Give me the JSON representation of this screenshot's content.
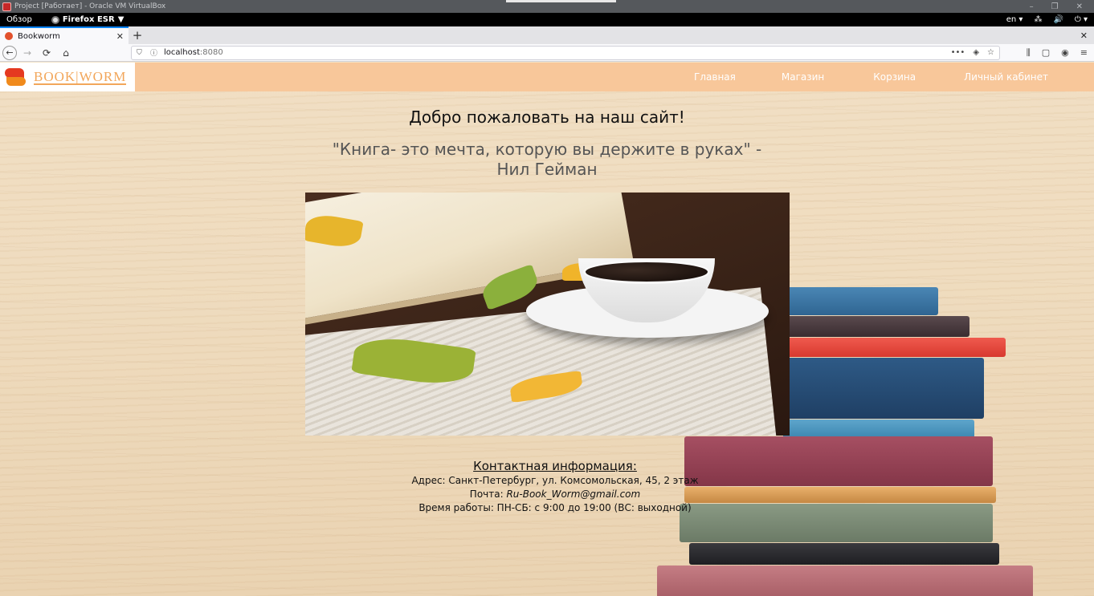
{
  "vbox": {
    "title": "Project [Работает] - Oracle VM VirtualBox",
    "controls": [
      "–",
      "❐",
      "✕"
    ]
  },
  "gnome": {
    "overview": "Обзор",
    "app_name": "Firefox ESR",
    "app_arrow": "▼",
    "lang": "en ▾",
    "tray": [
      "⁂",
      "🔊",
      "⏻ ▾"
    ]
  },
  "browser": {
    "tab_title": "Bookworm",
    "tab_close": "✕",
    "new_tab": "+",
    "window_close": "✕",
    "back": "←",
    "forward": "→",
    "reload": "⟳",
    "home": "⌂",
    "url_host": "localhost",
    "url_port": ":8080",
    "url_right": [
      "•••",
      "◈",
      "☆"
    ],
    "toolbar_icons": [
      "⫼",
      "▢",
      "◉",
      "≡"
    ]
  },
  "site": {
    "logo_text": "BOOK|WORM",
    "nav": [
      "Главная",
      "Магазин",
      "Корзина",
      "Личный кабинет"
    ],
    "welcome": "Добро пожаловать на наш сайт!",
    "quote_line1": "\"Книга- это мечта, которую вы держите в руках\" -",
    "quote_line2": "Нил Гейман",
    "contacts": {
      "title": "Контактная информация:",
      "address": "Адрес: Санкт-Петербург, ул. Комсомольская, 45, 2 этаж",
      "email_label": "Почта: ",
      "email": "Ru-Book_Worm@gmail.com",
      "hours": "Время работы: ПН-СБ: с 9:00 до 19:00 (ВС: выходной)"
    }
  },
  "colors": {
    "header_bg": "#f8c79a",
    "nav_text": "#ffffff",
    "logo_red": "#e53920",
    "logo_orange": "#f2a65a"
  }
}
